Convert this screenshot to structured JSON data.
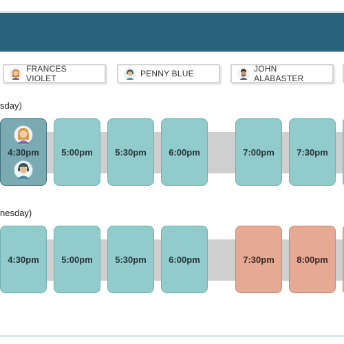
{
  "header": {
    "color": "#29627c"
  },
  "staff_chips": [
    {
      "name": "FRANCES VIOLET",
      "icon": "frances-avatar-icon"
    },
    {
      "name": "PENNY BLUE",
      "icon": "penny-avatar-icon"
    },
    {
      "name": "JOHN ALABASTER",
      "icon": "john-avatar-icon"
    }
  ],
  "schedule": {
    "day1": {
      "label": "sday)",
      "slots": [
        "4:30pm",
        "5:00pm",
        "5:30pm",
        "6:00pm",
        "7:00pm",
        "7:30pm"
      ],
      "selected": "4:30pm"
    },
    "day2": {
      "label": "nesday)",
      "slots": [
        "4:30pm",
        "5:00pm",
        "5:30pm",
        "6:00pm",
        "7:30pm",
        "8:00pm"
      ],
      "busy": [
        "7:30pm",
        "8:00pm"
      ]
    }
  },
  "colors": {
    "available": "#92cbcb",
    "busy": "#e5a994",
    "selected": "#7aabb2"
  }
}
